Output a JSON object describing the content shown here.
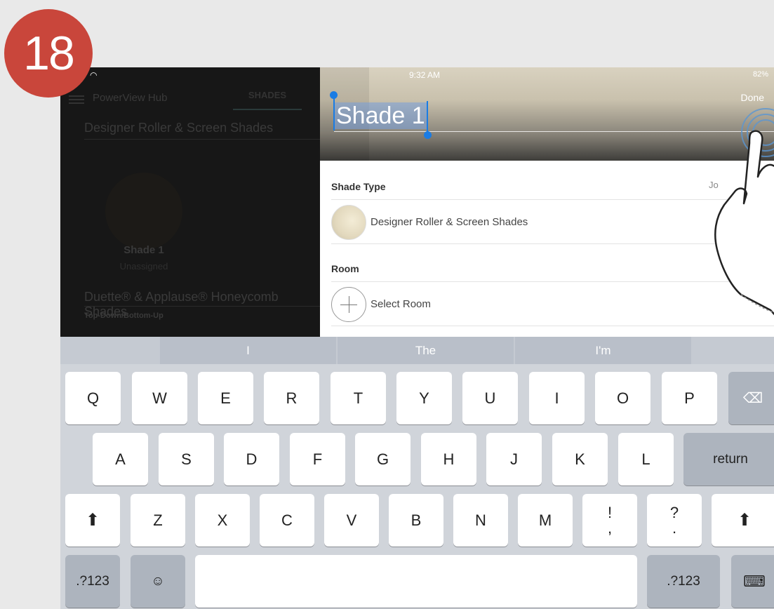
{
  "step": {
    "number": "18"
  },
  "status_bar": {
    "time": "9:32 AM",
    "battery": "82%"
  },
  "left_pane": {
    "hub_title": "PowerView Hub",
    "tab": "SHADES",
    "category_1": "Designer Roller & Screen Shades",
    "shade_name": "Shade 1",
    "shade_status": "Unassigned",
    "category_2": "Duette® & Applause® Honeycomb Shades",
    "category_2_sub": "Top-Down/Bottom-Up"
  },
  "detail": {
    "done_label": "Done",
    "name_value": "Shade 1",
    "shade_type_label": "Shade Type",
    "shade_type_value": "Designer Roller & Screen Shades",
    "join_partial": "Jo",
    "room_label": "Room",
    "select_room": "Select Room"
  },
  "suggestions": [
    "I",
    "The",
    "I'm"
  ],
  "keyboard": {
    "row1": [
      "Q",
      "W",
      "E",
      "R",
      "T",
      "Y",
      "U",
      "I",
      "O",
      "P"
    ],
    "row2": [
      "A",
      "S",
      "D",
      "F",
      "G",
      "H",
      "J",
      "K",
      "L"
    ],
    "return_label": "return",
    "row3": [
      "Z",
      "X",
      "C",
      "V",
      "B",
      "N",
      "M"
    ],
    "punct1_top": "!",
    "punct1_bottom": ",",
    "punct2_top": "?",
    "punct2_bottom": ".",
    "numbers_label": ".?123",
    "emoji_glyph": "☺",
    "shift_glyph": "⬆",
    "delete_glyph": "⌫",
    "hide_keyboard_glyph": "⌨"
  }
}
